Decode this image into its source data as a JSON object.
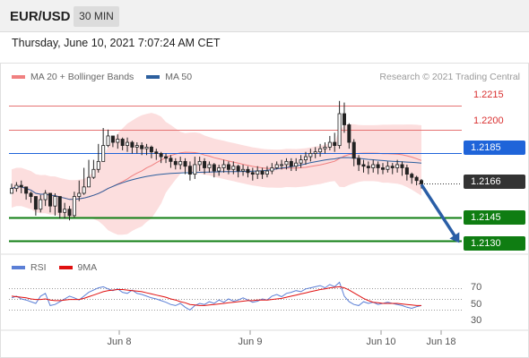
{
  "header": {
    "symbol": "EUR/USD",
    "timeframe": "30 MIN",
    "datetime": "Thursday, June 10, 2021 7:07:24 AM CET"
  },
  "legend": {
    "ma20_label": "MA 20 + Bollinger Bands",
    "ma20_color": "#f08080",
    "ma50_label": "MA 50",
    "ma50_color": "#2c5f9e"
  },
  "copyright": "Research © 2021 Trading Central",
  "rsi_legend": {
    "rsi_label": "RSI",
    "rsi_color": "#5b7fd6",
    "ma9_label": "9MA",
    "ma9_color": "#e01010"
  },
  "levels": {
    "r2": "1.2215",
    "r1": "1.2200",
    "pivot": "1.2185",
    "last": "1.2166",
    "s1": "1.2145",
    "s2": "1.2130"
  },
  "rsi_ticks": [
    "70",
    "50",
    "30"
  ],
  "x_ticks": [
    "Jun 8",
    "Jun 9",
    "Jun 10",
    "Jun 18"
  ],
  "chart_data": {
    "type": "candlestick",
    "instrument": "EUR/USD",
    "interval": "30 MIN",
    "y_range": [
      1.2124,
      1.2228
    ],
    "levels": [
      {
        "value": 1.2215,
        "color": "#e57373",
        "style": "thin"
      },
      {
        "value": 1.22,
        "color": "#e57373",
        "style": "thin"
      },
      {
        "value": 1.2185,
        "color": "#1f64d9",
        "style": "thin"
      },
      {
        "value": 1.2166,
        "color": "#333333",
        "style": "dotted"
      },
      {
        "value": 1.2145,
        "color": "#0f7d12",
        "style": "thick"
      },
      {
        "value": 1.213,
        "color": "#0f7d12",
        "style": "thick"
      }
    ],
    "arrow": {
      "from": 1.2166,
      "to": 1.213,
      "color": "#2a5ea6"
    },
    "closes": [
      1.2163,
      1.2165,
      1.2164,
      1.216,
      1.2158,
      1.215,
      1.2156,
      1.216,
      1.2152,
      1.2158,
      1.2148,
      1.215,
      1.2146,
      1.2158,
      1.216,
      1.2164,
      1.217,
      1.2175,
      1.218,
      1.219,
      1.2196,
      1.2192,
      1.2194,
      1.219,
      1.2192,
      1.2189,
      1.219,
      1.2188,
      1.2189,
      1.2186,
      1.2185,
      1.2183,
      1.2182,
      1.218,
      1.2178,
      1.218,
      1.2177,
      1.2172,
      1.2178,
      1.218,
      1.2176,
      1.2178,
      1.2174,
      1.2176,
      1.2178,
      1.2175,
      1.2177,
      1.2174,
      1.2175,
      1.2173,
      1.2172,
      1.2174,
      1.2172,
      1.2174,
      1.2176,
      1.2178,
      1.2178,
      1.218,
      1.2177,
      1.2179,
      1.2181,
      1.2183,
      1.2185,
      1.2186,
      1.2188,
      1.2189,
      1.2192,
      1.219,
      1.221,
      1.2203,
      1.2192,
      1.2182,
      1.2178,
      1.2177,
      1.2176,
      1.2178,
      1.2176,
      1.2175,
      1.2177,
      1.2176,
      1.2178,
      1.2176,
      1.2172,
      1.217,
      1.2168,
      1.2166
    ],
    "highs": [
      1.2166,
      1.2167,
      1.2168,
      1.2164,
      1.2161,
      1.2157,
      1.2159,
      1.2162,
      1.216,
      1.216,
      1.2158,
      1.2154,
      1.2152,
      1.2161,
      1.2168,
      1.2176,
      1.2181,
      1.2181,
      1.2191,
      1.2201,
      1.22,
      1.2196,
      1.2197,
      1.2195,
      1.2195,
      1.2193,
      1.2192,
      1.2192,
      1.2191,
      1.219,
      1.2188,
      1.2186,
      1.2185,
      1.2184,
      1.2182,
      1.2183,
      1.2182,
      1.218,
      1.2183,
      1.2183,
      1.2182,
      1.218,
      1.2179,
      1.2178,
      1.2181,
      1.218,
      1.218,
      1.2178,
      1.2178,
      1.2177,
      1.2176,
      1.2177,
      1.2176,
      1.2177,
      1.2179,
      1.218,
      1.2181,
      1.2182,
      1.2182,
      1.2182,
      1.2184,
      1.2186,
      1.2188,
      1.2189,
      1.2191,
      1.2192,
      1.2196,
      1.2198,
      1.2218,
      1.2217,
      1.2204,
      1.2194,
      1.2184,
      1.2181,
      1.218,
      1.2181,
      1.218,
      1.2179,
      1.218,
      1.2179,
      1.2181,
      1.218,
      1.2178,
      1.2173,
      1.2171,
      1.2169
    ],
    "lows": [
      1.216,
      1.2161,
      1.216,
      1.2156,
      1.2154,
      1.2146,
      1.2148,
      1.2152,
      1.2148,
      1.2146,
      1.2144,
      1.2144,
      1.2143,
      1.2145,
      1.2155,
      1.2159,
      1.2164,
      1.2169,
      1.2173,
      1.218,
      1.2189,
      1.2189,
      1.2188,
      1.2187,
      1.2186,
      1.2185,
      1.2185,
      1.2184,
      1.2184,
      1.2182,
      1.2181,
      1.2179,
      1.2179,
      1.2176,
      1.2175,
      1.2175,
      1.2172,
      1.2168,
      1.2169,
      1.2174,
      1.2172,
      1.2173,
      1.217,
      1.2171,
      1.2173,
      1.2172,
      1.2172,
      1.217,
      1.2171,
      1.217,
      1.2168,
      1.2169,
      1.2169,
      1.217,
      1.2172,
      1.2175,
      1.2175,
      1.2175,
      1.2174,
      1.2174,
      1.2176,
      1.2178,
      1.218,
      1.2182,
      1.2183,
      1.2185,
      1.2187,
      1.2186,
      1.2188,
      1.2198,
      1.2188,
      1.2177,
      1.2174,
      1.2173,
      1.2172,
      1.2173,
      1.2172,
      1.2172,
      1.2173,
      1.2172,
      1.2173,
      1.2171,
      1.2168,
      1.2166,
      1.2165,
      1.2163
    ],
    "rsi": {
      "range": [
        0,
        100
      ],
      "ticks": [
        70,
        50,
        30
      ],
      "rsi_values": [
        52,
        55,
        50,
        48,
        45,
        42,
        55,
        60,
        38,
        40,
        45,
        50,
        55,
        52,
        48,
        55,
        62,
        66,
        70,
        72,
        68,
        65,
        68,
        62,
        60,
        66,
        60,
        58,
        55,
        52,
        50,
        47,
        44,
        40,
        38,
        42,
        35,
        30,
        38,
        42,
        40,
        45,
        42,
        48,
        44,
        50,
        46,
        48,
        52,
        48,
        44,
        46,
        50,
        48,
        55,
        58,
        54,
        60,
        62,
        65,
        63,
        68,
        70,
        72,
        74,
        70,
        76,
        72,
        80,
        55,
        45,
        40,
        38,
        45,
        42,
        44,
        40,
        42,
        44,
        42,
        40,
        38,
        35,
        33,
        36,
        38
      ],
      "ma9_values": [
        55,
        54,
        53,
        52,
        50,
        49,
        49,
        50,
        48,
        47,
        47,
        48,
        49,
        49,
        49,
        51,
        54,
        57,
        60,
        63,
        65,
        66,
        67,
        67,
        66,
        65,
        64,
        63,
        61,
        59,
        57,
        55,
        53,
        50,
        48,
        45,
        43,
        40,
        39,
        38,
        38,
        39,
        40,
        41,
        42,
        43,
        44,
        45,
        46,
        47,
        47,
        48,
        48,
        48,
        49,
        50,
        51,
        53,
        55,
        57,
        59,
        61,
        63,
        65,
        67,
        68,
        70,
        71,
        72,
        70,
        66,
        61,
        56,
        51,
        47,
        44,
        43,
        42,
        42,
        42,
        42,
        41,
        40,
        39,
        38,
        38
      ]
    },
    "x_axis_labels": [
      "Jun 8",
      "Jun 9",
      "Jun 10",
      "Jun 18"
    ]
  }
}
